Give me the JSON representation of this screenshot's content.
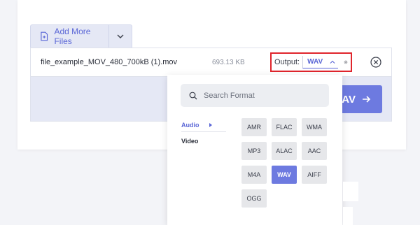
{
  "toolbar": {
    "add_more_label": "Add More Files"
  },
  "file": {
    "name": "file_example_MOV_480_700kB (1).mov",
    "size": "693.13 KB"
  },
  "output": {
    "label": "Output:",
    "value": "WAV"
  },
  "convert": {
    "label_partial": "AV"
  },
  "dropdown": {
    "search_placeholder": "Search Format",
    "categories": [
      {
        "label": "Audio",
        "active": true
      },
      {
        "label": "Video",
        "active": false
      }
    ],
    "formats": [
      "AMR",
      "FLAC",
      "WMA",
      "MP3",
      "ALAC",
      "AAC",
      "M4A",
      "WAV",
      "AIFF",
      "OGG"
    ],
    "selected": "WAV"
  },
  "colors": {
    "accent": "#6d7ae0",
    "accent_text": "#5a66d6",
    "highlight_border": "#e0252c"
  },
  "icons": {
    "add_file": "file-plus-icon",
    "caret": "chevron-down-icon",
    "output_caret": "chevron-up-icon",
    "settings": "gear-icon",
    "close": "close-circle-icon",
    "search": "search-icon",
    "convert_arrow": "arrow-right-icon"
  }
}
